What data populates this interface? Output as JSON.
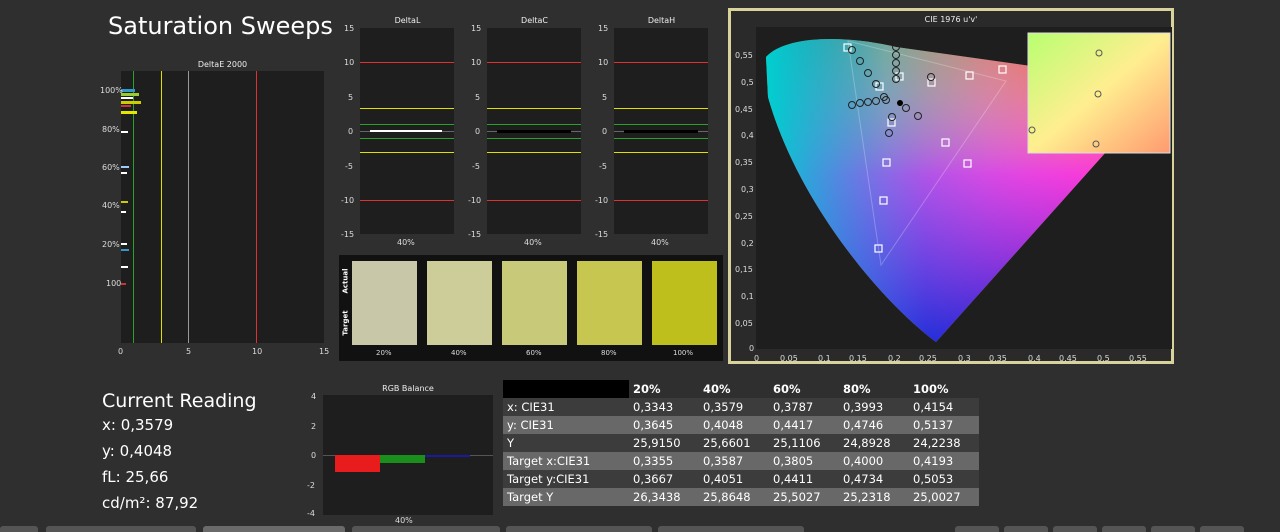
{
  "page": {
    "title": "Saturation Sweeps"
  },
  "deltae": {
    "title": "DeltaE 2000",
    "xticks": [
      "0",
      "5",
      "10",
      "15"
    ],
    "yticks": [
      "100%",
      "80%",
      "60%",
      "40%",
      "20%",
      "100"
    ],
    "colors": {
      "ok": "#2aa12a",
      "warn": "#e0e000",
      "bad": "#e03030",
      "white": "#bbbbbb"
    }
  },
  "delta_panels": [
    {
      "title": "DeltaL",
      "xlabel": "40%"
    },
    {
      "title": "DeltaC",
      "xlabel": "40%"
    },
    {
      "title": "DeltaH",
      "xlabel": "40%"
    }
  ],
  "delta_yticks": [
    "15",
    "10",
    "5",
    "0",
    "-5",
    "-10",
    "-15"
  ],
  "swatches": {
    "row_labels": [
      "Actual",
      "Target"
    ],
    "labels": [
      "20%",
      "40%",
      "60%",
      "80%",
      "100%"
    ],
    "colors": [
      "#c8c8a8",
      "#cdcd9a",
      "#c9c97a",
      "#c6c650",
      "#bebe1c"
    ]
  },
  "cie": {
    "title": "CIE 1976 u'v'",
    "xticks": [
      "0",
      "0,05",
      "0,1",
      "0,15",
      "0,2",
      "0,25",
      "0,3",
      "0,35",
      "0,4",
      "0,45",
      "0,5",
      "0,55"
    ],
    "yticks": [
      "0,55",
      "0,5",
      "0,45",
      "0,4",
      "0,35",
      "0,3",
      "0,25",
      "0,2",
      "0,15",
      "0,1",
      "0,05",
      "0"
    ]
  },
  "reading": {
    "title": "Current Reading",
    "x": "x: 0,3579",
    "y": "y: 0,4048",
    "fl": "fL: 25,66",
    "cd": "cd/m²: 87,92"
  },
  "rgb_balance": {
    "title": "RGB Balance",
    "yticks": [
      "4",
      "2",
      "0",
      "-2",
      "-4"
    ],
    "xlabel": "40%",
    "colors": {
      "r": "#e81c1c",
      "g": "#1b8f1b",
      "b": "#1a1aa0"
    }
  },
  "table": {
    "headers": [
      "",
      "20%",
      "40%",
      "60%",
      "80%",
      "100%"
    ],
    "rows": [
      [
        "x: CIE31",
        "0,3343",
        "0,3579",
        "0,3787",
        "0,3993",
        "0,4154"
      ],
      [
        "y: CIE31",
        "0,3645",
        "0,4048",
        "0,4417",
        "0,4746",
        "0,5137"
      ],
      [
        "Y",
        "25,9150",
        "25,6601",
        "25,1106",
        "24,8928",
        "24,2238"
      ],
      [
        "Target x:CIE31",
        "0,3355",
        "0,3587",
        "0,3805",
        "0,4000",
        "0,4193"
      ],
      [
        "Target y:CIE31",
        "0,3667",
        "0,4051",
        "0,4411",
        "0,4734",
        "0,5053"
      ],
      [
        "Target Y",
        "26,3438",
        "25,8648",
        "25,5027",
        "25,2318",
        "25,0027"
      ]
    ]
  }
}
